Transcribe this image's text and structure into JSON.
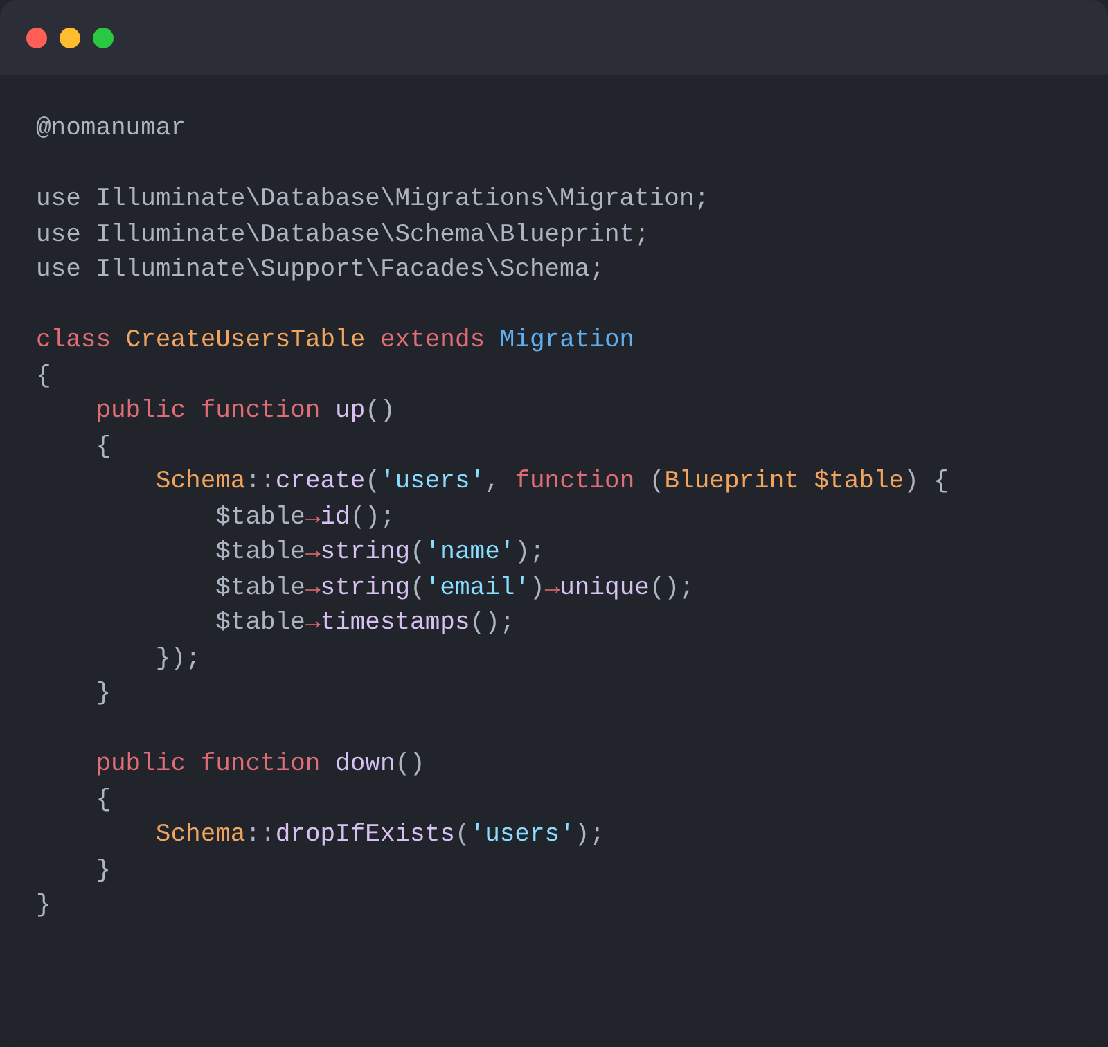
{
  "window": {
    "controls": [
      {
        "kind": "close"
      },
      {
        "kind": "minimize"
      },
      {
        "kind": "maximize"
      }
    ]
  },
  "code_blocks": [
    [
      [
        {
          "kind": "plain",
          "text": "@nomanumar"
        }
      ]
    ],
    [
      [
        {
          "kind": "plain",
          "text": "use Illuminate\\Database\\Migrations\\Migration;"
        }
      ],
      [
        {
          "kind": "plain",
          "text": "use Illuminate\\Database\\Schema\\Blueprint;"
        }
      ],
      [
        {
          "kind": "plain",
          "text": "use Illuminate\\Support\\Facades\\Schema;"
        }
      ]
    ],
    [
      [
        {
          "kind": "keyword",
          "text": "class"
        },
        {
          "kind": "type",
          "text": " CreateUsersTable"
        },
        {
          "kind": "keyword",
          "text": " extends"
        },
        {
          "kind": "classref",
          "text": " Migration"
        }
      ],
      [
        {
          "kind": "plain",
          "text": "{"
        }
      ],
      [
        {
          "kind": "keyword",
          "text": "    public function"
        },
        {
          "kind": "method",
          "text": " up"
        },
        {
          "kind": "plain",
          "text": "()"
        }
      ],
      [
        {
          "kind": "plain",
          "text": "    {"
        }
      ],
      [
        {
          "kind": "type",
          "text": "        Schema"
        },
        {
          "kind": "plain",
          "text": "::"
        },
        {
          "kind": "method",
          "text": "create"
        },
        {
          "kind": "plain",
          "text": "("
        },
        {
          "kind": "string",
          "text": "'users'"
        },
        {
          "kind": "plain",
          "text": ","
        },
        {
          "kind": "keyword",
          "text": " function"
        },
        {
          "kind": "plain",
          "text": " ("
        },
        {
          "kind": "type",
          "text": "Blueprint $table"
        },
        {
          "kind": "plain",
          "text": ") {"
        }
      ],
      [
        {
          "kind": "plain",
          "text": "            $table"
        },
        {
          "kind": "arrow",
          "text": "→"
        },
        {
          "kind": "method",
          "text": "id"
        },
        {
          "kind": "plain",
          "text": "();"
        }
      ],
      [
        {
          "kind": "plain",
          "text": "            $table"
        },
        {
          "kind": "arrow",
          "text": "→"
        },
        {
          "kind": "method",
          "text": "string"
        },
        {
          "kind": "plain",
          "text": "("
        },
        {
          "kind": "string",
          "text": "'name'"
        },
        {
          "kind": "plain",
          "text": ");"
        }
      ],
      [
        {
          "kind": "plain",
          "text": "            $table"
        },
        {
          "kind": "arrow",
          "text": "→"
        },
        {
          "kind": "method",
          "text": "string"
        },
        {
          "kind": "plain",
          "text": "("
        },
        {
          "kind": "string",
          "text": "'email'"
        },
        {
          "kind": "plain",
          "text": ")"
        },
        {
          "kind": "arrow",
          "text": "→"
        },
        {
          "kind": "method",
          "text": "unique"
        },
        {
          "kind": "plain",
          "text": "();"
        }
      ],
      [
        {
          "kind": "plain",
          "text": "            $table"
        },
        {
          "kind": "arrow",
          "text": "→"
        },
        {
          "kind": "method",
          "text": "timestamps"
        },
        {
          "kind": "plain",
          "text": "();"
        }
      ],
      [
        {
          "kind": "plain",
          "text": "        });"
        }
      ],
      [
        {
          "kind": "plain",
          "text": "    }"
        }
      ]
    ],
    [
      [
        {
          "kind": "keyword",
          "text": "    public function"
        },
        {
          "kind": "method",
          "text": " down"
        },
        {
          "kind": "plain",
          "text": "()"
        }
      ],
      [
        {
          "kind": "plain",
          "text": "    {"
        }
      ],
      [
        {
          "kind": "type",
          "text": "        Schema"
        },
        {
          "kind": "plain",
          "text": "::"
        },
        {
          "kind": "method",
          "text": "dropIfExists"
        },
        {
          "kind": "plain",
          "text": "("
        },
        {
          "kind": "string",
          "text": "'users'"
        },
        {
          "kind": "plain",
          "text": ");"
        }
      ],
      [
        {
          "kind": "plain",
          "text": "    }"
        }
      ],
      [
        {
          "kind": "plain",
          "text": "}"
        }
      ]
    ]
  ]
}
